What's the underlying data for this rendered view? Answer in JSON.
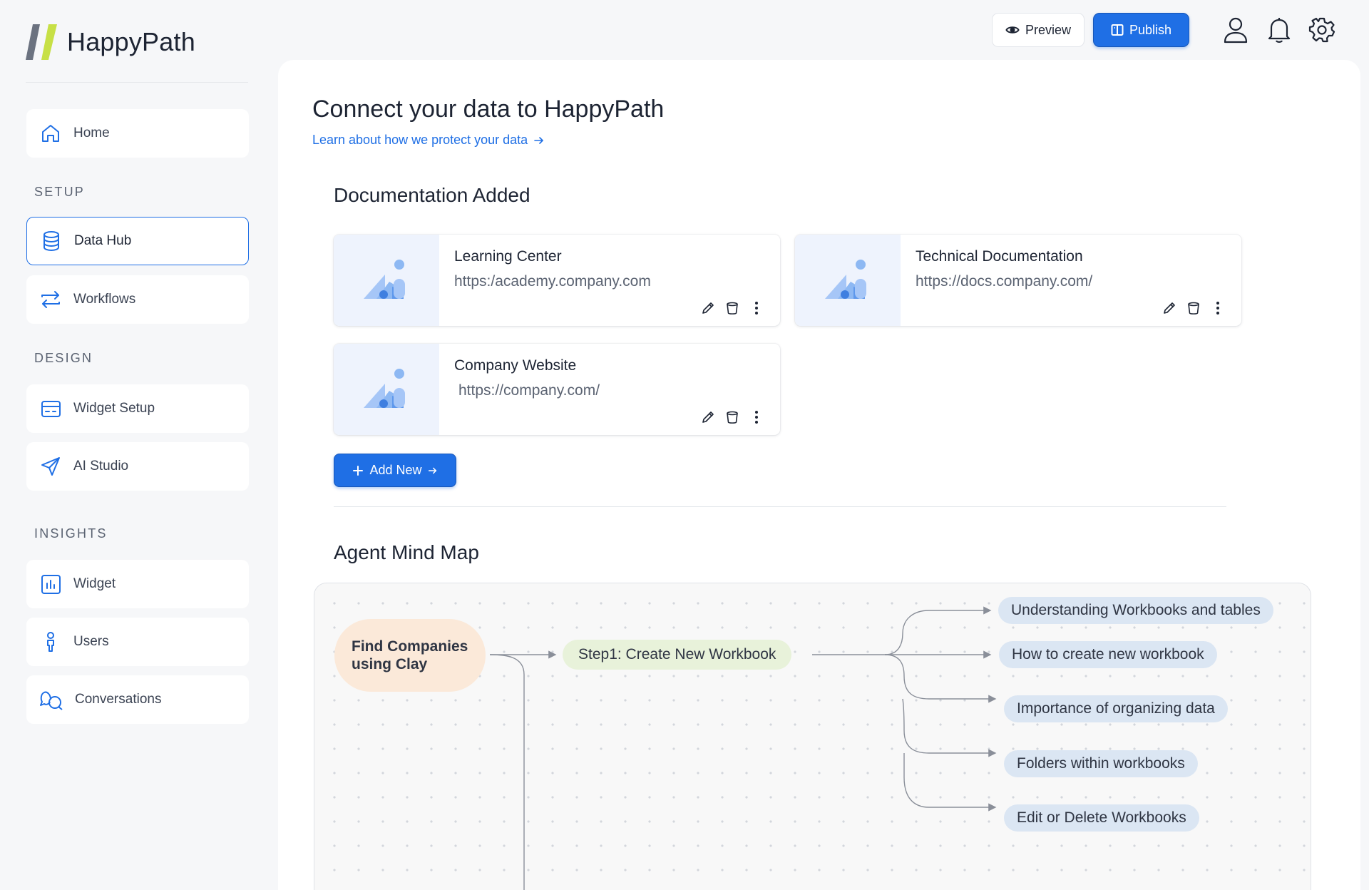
{
  "app": {
    "name": "HappyPath"
  },
  "colors": {
    "accent": "#1f6fe5",
    "logo_gray": "#6b7280",
    "logo_green": "#c7e046",
    "root_node": "#fbe9d9",
    "step_node": "#e8f2da",
    "leaf_node": "#dbe6f3"
  },
  "topbar": {
    "preview_label": "Preview",
    "publish_label": "Publish"
  },
  "sidebar": {
    "home": "Home",
    "sections": [
      {
        "label": "SETUP",
        "items": [
          {
            "label": "Data Hub",
            "icon": "database-icon",
            "active": true
          },
          {
            "label": "Workflows",
            "icon": "repeat-icon"
          }
        ]
      },
      {
        "label": "DESIGN",
        "items": [
          {
            "label": "Widget Setup",
            "icon": "card-icon"
          },
          {
            "label": "AI Studio",
            "icon": "send-icon"
          }
        ]
      },
      {
        "label": "INSIGHTS",
        "items": [
          {
            "label": "Widget",
            "icon": "chart-icon"
          },
          {
            "label": "Users",
            "icon": "person-icon"
          },
          {
            "label": "Conversations",
            "icon": "chat-icon"
          }
        ]
      }
    ]
  },
  "main": {
    "title": "Connect your data to HappyPath",
    "protect_link": "Learn about how we protect your data",
    "documentation": {
      "title": "Documentation Added",
      "items": [
        {
          "name": "Learning Center",
          "url": "https:/academy.company.com"
        },
        {
          "name": "Technical Documentation",
          "url": "https://docs.company.com/"
        },
        {
          "name": "Company Website",
          "url": "https://company.com/"
        }
      ],
      "add_label": "Add New"
    },
    "mindmap": {
      "title": "Agent Mind Map",
      "root": "Find Companies using Clay",
      "step": "Step1: Create New Workbook",
      "leaves": [
        "Understanding Workbooks and tables",
        "How to create new workbook",
        "Importance of organizing data",
        "Folders within workbooks",
        "Edit or Delete Workbooks"
      ]
    }
  }
}
